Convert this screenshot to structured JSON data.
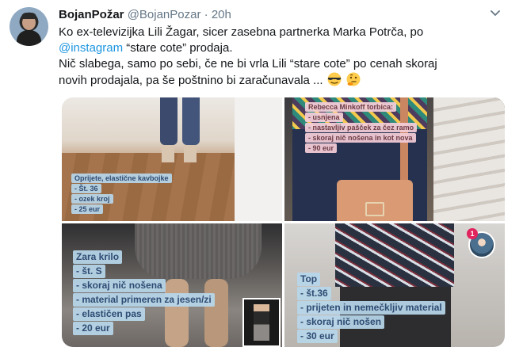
{
  "tweet": {
    "display_name": "BojanPožar",
    "handle": "@BojanPozar",
    "separator": "·",
    "time": "20h",
    "line1": "Ko ex-televizijka Lili Žagar, sicer zasebna partnerka Marka Potrča, po",
    "mention": "@instagram",
    "line2_rest": " “stare cote” prodaja.",
    "line3": "Nič slabega, samo po sebi, če ne bi vrla Lili “stare cote” po cenah skoraj",
    "line4": "novih prodajala, pa še poštnino bi zaračunavala ...",
    "emoji1": "sunglasses-emoji",
    "emoji2": "thinking-emoji"
  },
  "media": {
    "photo1": [
      "Oprijete, elastične kavbojke",
      "- Št. 36",
      "- ozek kroj",
      "- 25 eur"
    ],
    "photo2": [
      "Rebecca Minkoff torbica:",
      "- usnjena",
      "- nastavljiv pašček za čez ramo",
      "- skoraj nič nošena in kot nova",
      "- 90 eur"
    ],
    "photo3": [
      "Zara krilo",
      "- št. S",
      "- skoraj nič nošena",
      "- material primeren za jesen/zi",
      "- elastičen pas",
      "- 20 eur"
    ],
    "photo4": [
      "Top",
      "- št.36",
      "- prijeten in nemečkljiv material",
      "- skoraj nič nošen",
      "- 30 eur"
    ],
    "notification_count": "1"
  },
  "colors": {
    "mention": "#1b95e0",
    "caption_bg": "#b7d6ea",
    "caption_text": "#2e4b73"
  }
}
